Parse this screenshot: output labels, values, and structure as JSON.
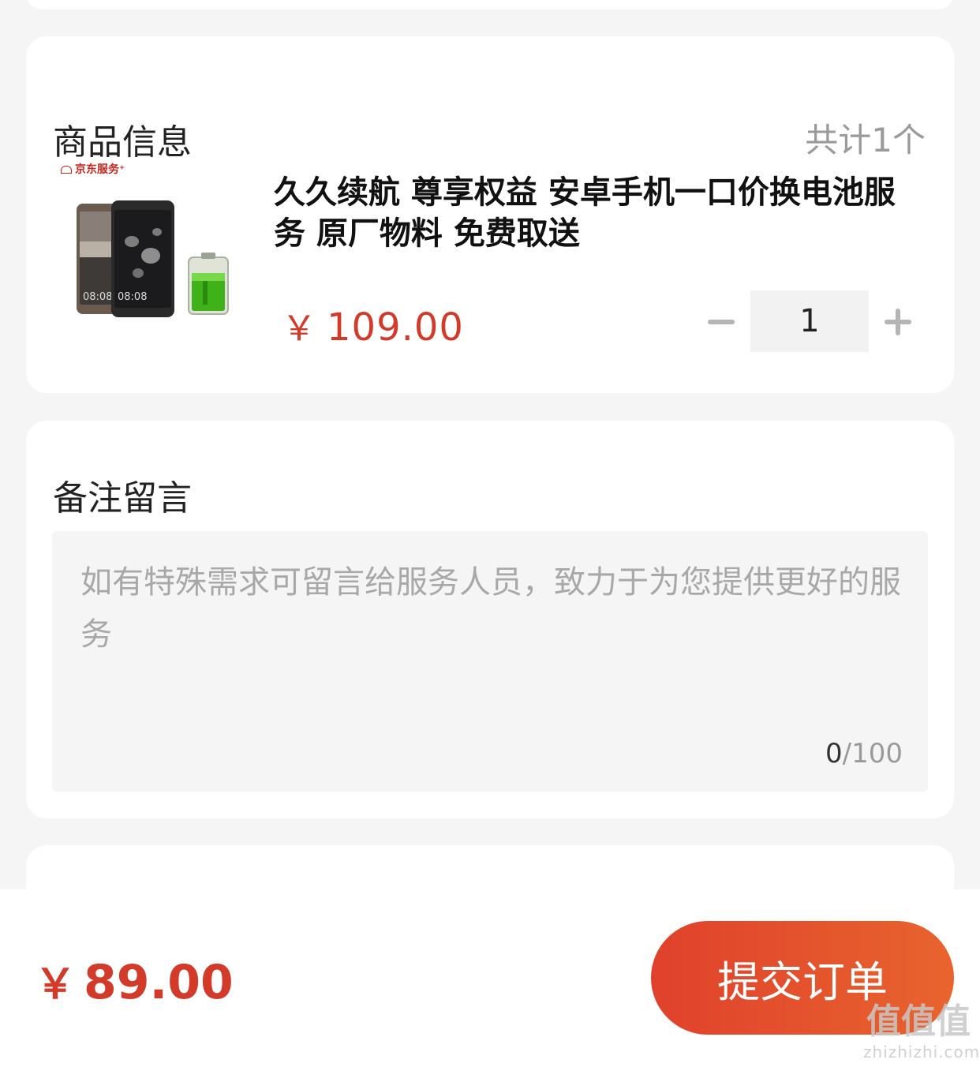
{
  "product_section": {
    "title": "商品信息",
    "count_label": "共计1个",
    "item": {
      "brand_badge": "京东服务⁺",
      "name": "久久续航 尊享权益 安卓手机一口价换电池服务 原厂物料 免费取送",
      "price_symbol": "￥",
      "price": "109.00",
      "quantity": "1",
      "screen_time": "08:08"
    }
  },
  "remark_section": {
    "title": "备注留言",
    "placeholder": "如有特殊需求可留言给服务人员，致力于为您提供更好的服务",
    "value": "",
    "char_current": "0",
    "char_separator": "/",
    "char_max": "100"
  },
  "footer": {
    "total_symbol": "￥",
    "total": "89.00",
    "submit_label": "提交订单"
  },
  "watermark": {
    "logo_text": "值值值",
    "site": "zhizhizhi.com"
  },
  "colors": {
    "accent_red": "#d23a2a",
    "submit_gradient_start": "#e0412c",
    "submit_gradient_end": "#e8642e",
    "page_bg": "#f5f5f5"
  }
}
